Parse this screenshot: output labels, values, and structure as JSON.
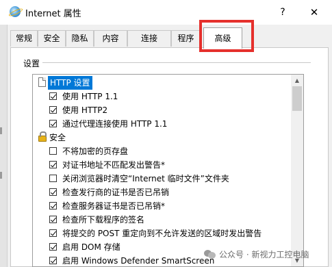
{
  "window": {
    "title": "Internet 属性",
    "help_label": "?",
    "close_label": "✕",
    "app_icon": "internet-options-globe-icon"
  },
  "tabs": [
    {
      "label": "常规",
      "active": false
    },
    {
      "label": "安全",
      "active": false
    },
    {
      "label": "隐私",
      "active": false
    },
    {
      "label": "内容",
      "active": false
    },
    {
      "label": "连接",
      "active": false
    },
    {
      "label": "程序",
      "active": false
    },
    {
      "label": "高级",
      "active": true
    }
  ],
  "annotation": {
    "highlight_color": "#e5302c",
    "target": "高级"
  },
  "settings": {
    "label": "设置",
    "items": [
      {
        "type": "group",
        "icon": "document-icon",
        "label": "HTTP 设置",
        "selected": true
      },
      {
        "type": "checkbox",
        "checked": true,
        "label": "使用 HTTP 1.1"
      },
      {
        "type": "checkbox",
        "checked": true,
        "label": "使用 HTTP2"
      },
      {
        "type": "checkbox",
        "checked": true,
        "label": "通过代理连接使用 HTTP 1.1"
      },
      {
        "type": "group",
        "icon": "lock-icon",
        "label": "安全",
        "selected": false
      },
      {
        "type": "checkbox",
        "checked": false,
        "label": "不将加密的页存盘"
      },
      {
        "type": "checkbox",
        "checked": true,
        "label": "对证书地址不匹配发出警告*"
      },
      {
        "type": "checkbox",
        "checked": false,
        "label": "关闭浏览器时清空“Internet 临时文件”文件夹"
      },
      {
        "type": "checkbox",
        "checked": true,
        "label": "检查发行商的证书是否已吊销"
      },
      {
        "type": "checkbox",
        "checked": true,
        "label": "检查服务器证书是否已吊销*"
      },
      {
        "type": "checkbox",
        "checked": true,
        "label": "检查所下载程序的签名"
      },
      {
        "type": "checkbox",
        "checked": true,
        "label": "将提交的 POST 重定向到不允许发送的区域时发出警告"
      },
      {
        "type": "checkbox",
        "checked": true,
        "label": "启用 DOM 存储"
      },
      {
        "type": "checkbox",
        "checked": true,
        "label": "启用 Windows Defender SmartScreen"
      }
    ]
  },
  "scrollbar": {
    "up_icon": "▲",
    "down_icon": "▼"
  },
  "watermark": {
    "text": "公众号 · 新视力工控电脑"
  },
  "colors": {
    "selection": "#0078d7",
    "panel": "#ffffff",
    "dialog": "#f0f0f0"
  }
}
